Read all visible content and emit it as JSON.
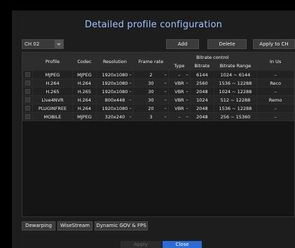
{
  "dialog": {
    "title": "Detailed profile configuration"
  },
  "toolbar": {
    "channel_value": "CH 02",
    "add_label": "Add",
    "delete_label": "Delete",
    "apply_to_ch_label": "Apply to CH"
  },
  "table": {
    "headers": {
      "profile": "Profile",
      "codec": "Codec",
      "resolution": "Resolution",
      "frame_rate": "Frame rate",
      "bitrate_control": "Bitrate control",
      "type": "Type",
      "bitrate": "Bitrate",
      "bitrate_range": "Bitrate Range",
      "in_use": "In Us"
    },
    "rows": [
      {
        "profile": "MJPEG",
        "codec": "MJPEG",
        "resolution": "1920x1080",
        "frame_rate": "2",
        "type": "–",
        "bitrate": "6144",
        "bitrate_range": "1024 ~ 6144",
        "in_use": "–"
      },
      {
        "profile": "H.264",
        "codec": "H.264",
        "resolution": "1920x1080",
        "frame_rate": "30",
        "type": "VBR",
        "bitrate": "2560",
        "bitrate_range": "1536 ~ 12288",
        "in_use": "Reco"
      },
      {
        "profile": "H.265",
        "codec": "H.265",
        "resolution": "1920x1080",
        "frame_rate": "30",
        "type": "VBR",
        "bitrate": "2048",
        "bitrate_range": "1024 ~ 12288",
        "in_use": "–"
      },
      {
        "profile": "Live4NVR",
        "codec": "H.264",
        "resolution": "800x448",
        "frame_rate": "30",
        "type": "VBR",
        "bitrate": "1024",
        "bitrate_range": "512 ~ 12288",
        "in_use": "Remo"
      },
      {
        "profile": "PLUGINFREE",
        "codec": "H.264",
        "resolution": "1920x1080",
        "frame_rate": "20",
        "type": "VBR",
        "bitrate": "2048",
        "bitrate_range": "1536 ~ 12288",
        "in_use": "–"
      },
      {
        "profile": "MOBILE",
        "codec": "MJPEG",
        "resolution": "320x240",
        "frame_rate": "3",
        "type": "–",
        "bitrate": "2048",
        "bitrate_range": "256 ~ 15360",
        "in_use": "–"
      }
    ]
  },
  "bottom_tabs": {
    "dewarping": "Dewarping",
    "wisestream": "WiseStream",
    "dynamic_gov": "Dynamic GOV & FPS"
  },
  "footer": {
    "apply_label": "Apply",
    "close_label": "Close"
  },
  "colors": {
    "title": "#9ec4ff",
    "primary_button": "#2b6bd6",
    "background": "#1d1d1d"
  }
}
